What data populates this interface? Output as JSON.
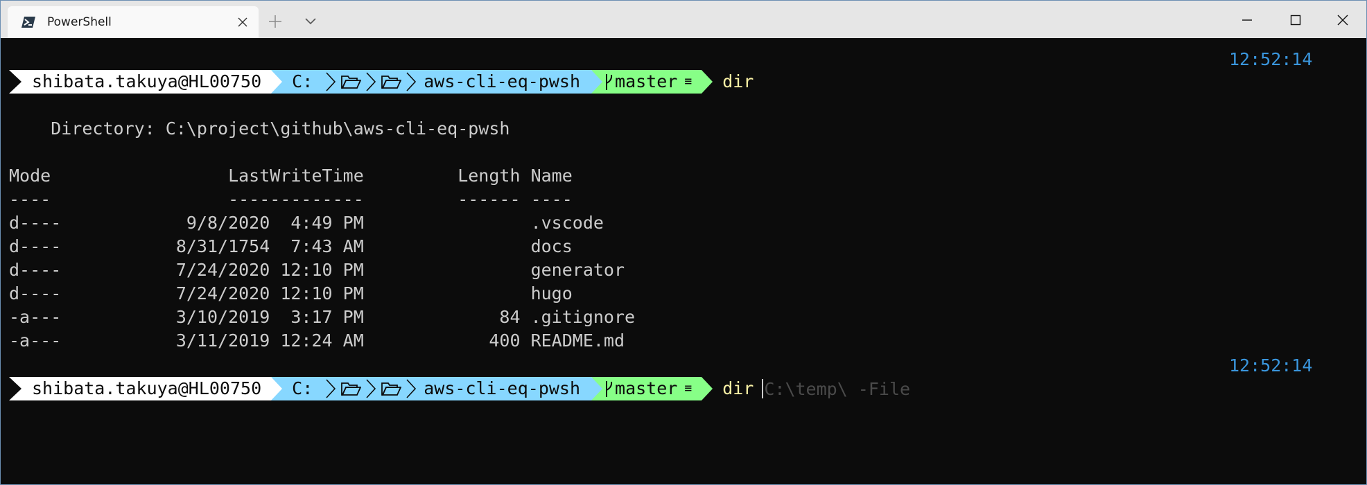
{
  "window": {
    "tab_title": "PowerShell",
    "tab_icon": "powershell-icon",
    "new_tab_icon": "plus-icon",
    "dropdown_icon": "chevron-down-icon",
    "controls": [
      "minimize-icon",
      "maximize-icon",
      "close-icon"
    ]
  },
  "colors": {
    "terminal_bg": "#0c0c0c",
    "text": "#cccccc",
    "clock": "#3a96dd",
    "command": "#f9f1a5",
    "segment_user": "#ffffff",
    "segment_path": "#87d7ff",
    "segment_git": "#87ff87",
    "suggestion": "#4a4a4a"
  },
  "prompts": [
    {
      "time": "12:52:14",
      "user": "shibata.takuya@HL00750",
      "drive": "C:",
      "dir": "aws-cli-eq-pwsh",
      "branch": "master",
      "branch_status": "≡",
      "command": "dir"
    },
    {
      "time": "12:52:14",
      "user": "shibata.takuya@HL00750",
      "drive": "C:",
      "dir": "aws-cli-eq-pwsh",
      "branch": "master",
      "branch_status": "≡",
      "command": "dir",
      "suggestion": "C:\\temp\\ -File"
    }
  ],
  "output": {
    "directory_line": "    Directory: C:\\project\\github\\aws-cli-eq-pwsh",
    "header": "Mode                 LastWriteTime         Length Name",
    "underline": "----                 -------------         ------ ----",
    "rows": [
      "d----            9/8/2020  4:49 PM                .vscode",
      "d----           8/31/1754  7:43 AM                docs",
      "d----           7/24/2020 12:10 PM                generator",
      "d----           7/24/2020 12:10 PM                hugo",
      "-a---           3/10/2019  3:17 PM             84 .gitignore",
      "-a---           3/11/2019 12:24 AM            400 README.md"
    ]
  }
}
